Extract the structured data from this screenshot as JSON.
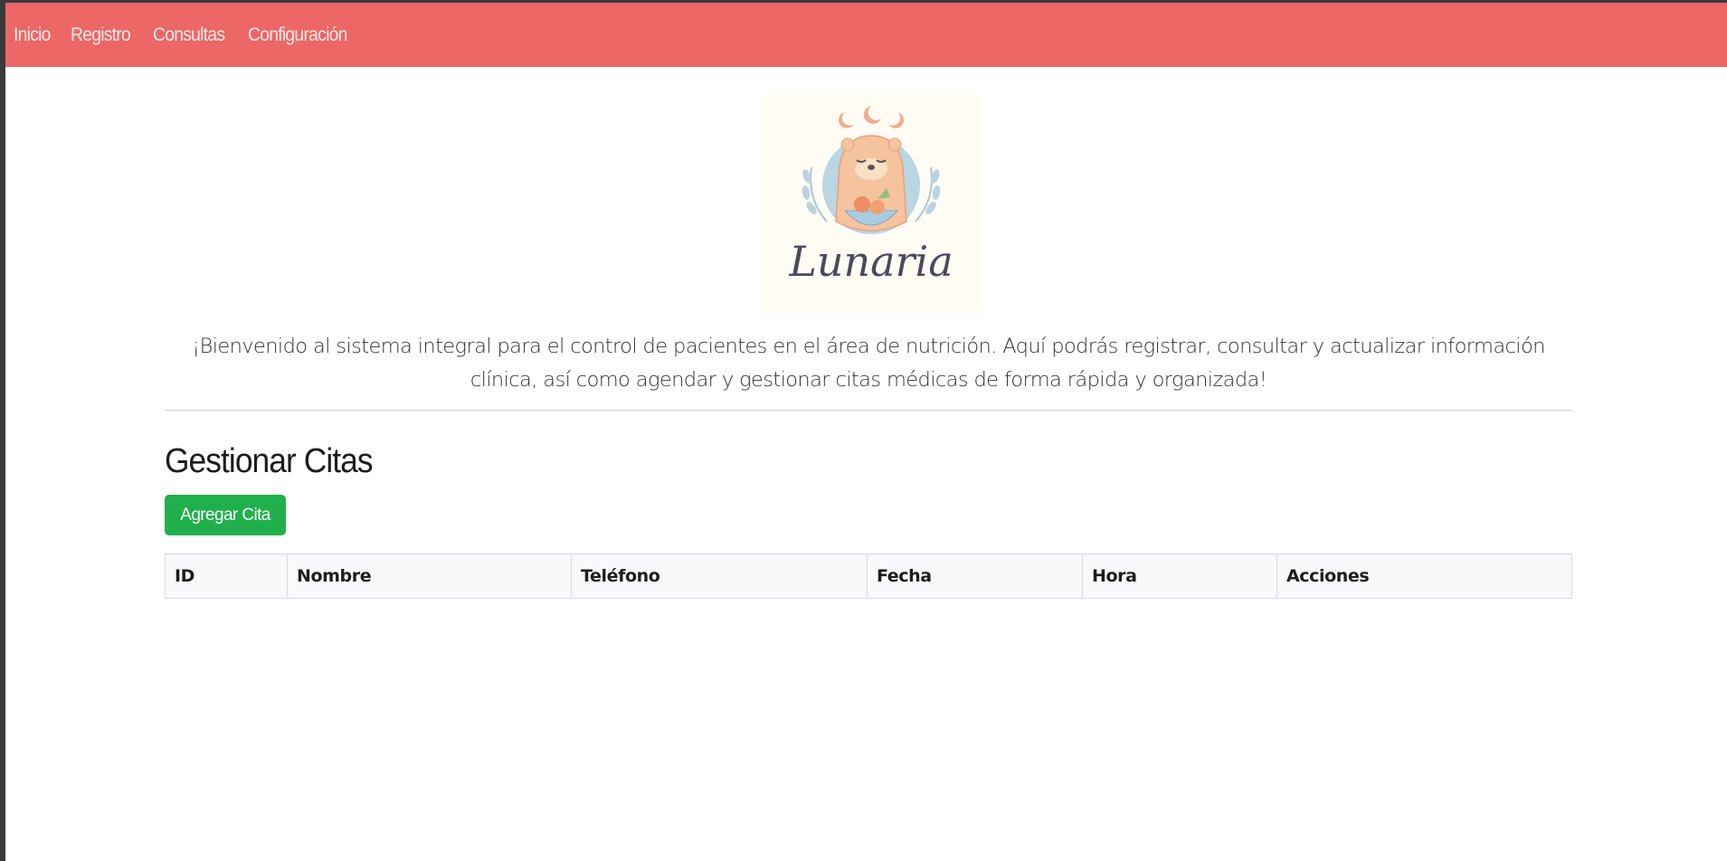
{
  "nav": {
    "items": [
      "Inicio",
      "Registro",
      "Consultas",
      "Configuración"
    ]
  },
  "logo": {
    "text": "Lunaria"
  },
  "intro": {
    "text": "¡Bienvenido al sistema integral para el control de pacientes en el área de nutrición. Aquí podrás registrar, consultar y actualizar información clínica, así como agendar y gestionar citas médicas de forma rápida y organizada!"
  },
  "section": {
    "title": "Gestionar Citas",
    "add_button": "Agregar Cita"
  },
  "table": {
    "headers": [
      "ID",
      "Nombre",
      "Teléfono",
      "Fecha",
      "Hora",
      "Acciones"
    ],
    "rows": []
  },
  "colors": {
    "navbar": "#ec6766",
    "add_button": "#20b04b"
  }
}
